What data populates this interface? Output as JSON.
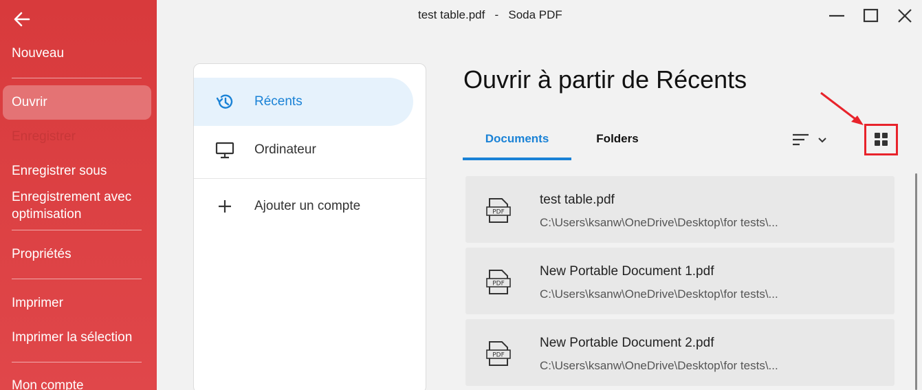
{
  "window": {
    "title": "test table.pdf",
    "separator": "-",
    "app_name": "Soda PDF"
  },
  "sidebar": {
    "items": [
      {
        "label": "Nouveau"
      },
      {
        "label": "Ouvrir"
      },
      {
        "label": "Enregistrer"
      },
      {
        "label": "Enregistrer sous"
      },
      {
        "label": "Enregistrement avec optimisation"
      },
      {
        "label": "Propriétés"
      },
      {
        "label": "Imprimer"
      },
      {
        "label": "Imprimer la sélection"
      },
      {
        "label": "Mon compte"
      }
    ]
  },
  "sources": {
    "items": [
      {
        "label": "Récents",
        "icon": "history-icon"
      },
      {
        "label": "Ordinateur",
        "icon": "monitor-icon"
      },
      {
        "label": "Ajouter un compte",
        "icon": "plus-icon"
      }
    ]
  },
  "main": {
    "title": "Ouvrir à partir de Récents",
    "tabs": [
      {
        "label": "Documents"
      },
      {
        "label": "Folders"
      }
    ],
    "files": [
      {
        "name": "test table.pdf",
        "path": "C:\\Users\\ksanw\\OneDrive\\Desktop\\for tests\\..."
      },
      {
        "name": "New Portable Document 1.pdf",
        "path": "C:\\Users\\ksanw\\OneDrive\\Desktop\\for tests\\..."
      },
      {
        "name": "New Portable Document 2.pdf",
        "path": "C:\\Users\\ksanw\\OneDrive\\Desktop\\for tests\\..."
      }
    ],
    "pdf_icon_text": "PDF"
  },
  "colors": {
    "sidebar": "#d83a3c",
    "accent": "#1a82d6",
    "highlight_box": "#e8232b"
  }
}
